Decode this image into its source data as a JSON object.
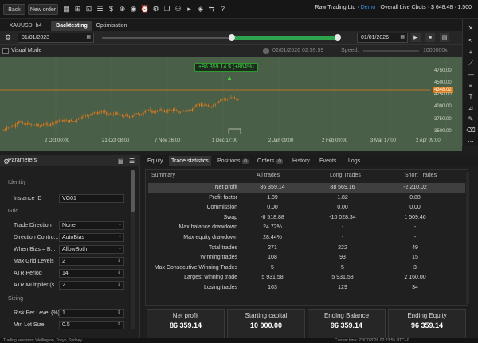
{
  "toolbar": {
    "back_label": "Back",
    "new_order_label": "New order",
    "account": {
      "broker": "Raw Trading Ltd",
      "mode": "Demo",
      "summary": "Overall Live Cbots",
      "balance": "$ 648.48",
      "leverage": "1:500"
    }
  },
  "tabs": {
    "symbol": "XAUUSD",
    "timeframe": "h4",
    "backtesting": "Backtesting",
    "optimisation": "Optimisation"
  },
  "dates": {
    "start": "01/01/2023",
    "end": "01/01/2026"
  },
  "visual_mode": {
    "label": "Visual Mode",
    "current_time": "02/01/2026 02:59:59",
    "speed_label": "Speed:",
    "speed_value": "1000000x"
  },
  "chart": {
    "pnl_badge": "+86 359.14 $ (+864%)",
    "price_tag": "4348.02",
    "y_ticks": [
      "4750.00",
      "4500.00",
      "4250.00",
      "4000.00",
      "3750.00",
      "3500.00"
    ],
    "x_ticks": [
      "2 Oct 00:00",
      "21 Oct 08:00",
      "7 Nov 16:00",
      "1 Dec 17:00",
      "2 Jan 09:00",
      "2 Feb 09:00",
      "3 Mar 17:00",
      "2 Apr 09:00"
    ],
    "colors": {
      "up": "#e07b1c",
      "down": "#e07b1c",
      "background": "#4a5f47",
      "price_line": "#e07b1c"
    }
  },
  "params": {
    "header": "Parameters",
    "sections": {
      "identity": "Identity",
      "grid": "Grid",
      "sizing": "Sizing"
    },
    "fields": [
      {
        "label": "Instance ID",
        "value": "VG01",
        "dropdown": false
      },
      {
        "label": "Trade Direction",
        "value": "None",
        "dropdown": true
      },
      {
        "label": "Direction Contro...",
        "value": "AutoBias",
        "dropdown": true
      },
      {
        "label": "When Bias = B...",
        "value": "AllowBoth",
        "dropdown": true
      },
      {
        "label": "Max Grid Levels",
        "value": "2",
        "dropdown": true
      },
      {
        "label": "ATR Period",
        "value": "14",
        "dropdown": true
      },
      {
        "label": "ATR Multiplier (s...",
        "value": "2",
        "dropdown": true
      },
      {
        "label": "Risk Per Level (%)",
        "value": "1",
        "dropdown": true
      },
      {
        "label": "Min Lot Size",
        "value": "0.5",
        "dropdown": true
      }
    ]
  },
  "results_tabs": [
    {
      "label": "Equity",
      "badge": ""
    },
    {
      "label": "Trade statistics",
      "badge": ""
    },
    {
      "label": "Positions",
      "badge": "0"
    },
    {
      "label": "Orders",
      "badge": "0"
    },
    {
      "label": "History",
      "badge": ""
    },
    {
      "label": "Events",
      "badge": ""
    },
    {
      "label": "Logs",
      "badge": ""
    }
  ],
  "stats": {
    "headers": [
      "Summary",
      "All trades",
      "Long Trades",
      "Short Trades"
    ],
    "rows": [
      [
        "Net profit",
        "86 359.14",
        "88 569.16",
        "-2 210.02"
      ],
      [
        "Profit factor",
        "1.89",
        "1.82",
        "0.88"
      ],
      [
        "Commission",
        "0.00",
        "0.00",
        "0.00"
      ],
      [
        "Swap",
        "-8 518.88",
        "-10 028.34",
        "1 509.46"
      ],
      [
        "Max balance drawdown",
        "24.72%",
        "-",
        "-"
      ],
      [
        "Max equity drawdown",
        "28.44%",
        "-",
        "-"
      ],
      [
        "Total trades",
        "271",
        "222",
        "49"
      ],
      [
        "Winning trades",
        "108",
        "93",
        "15"
      ],
      [
        "Max Consecutive Winning Trades",
        "5",
        "5",
        "3"
      ],
      [
        "Largest winning trade",
        "5 931.58",
        "5 931.58",
        "2 160.00"
      ],
      [
        "Losing trades",
        "163",
        "129",
        "34"
      ]
    ]
  },
  "cards": [
    {
      "label": "Net profit",
      "value": "86 359.14"
    },
    {
      "label": "Starting capital",
      "value": "10 000.00"
    },
    {
      "label": "Ending Balance",
      "value": "96 359.14"
    },
    {
      "label": "Ending Equity",
      "value": "96 359.14"
    }
  ],
  "status": {
    "left": "Trading sessions: Wellington, Tokyo, Sydney",
    "right": "Current time: 22/07/2026 02:23:55  UTC+0"
  }
}
